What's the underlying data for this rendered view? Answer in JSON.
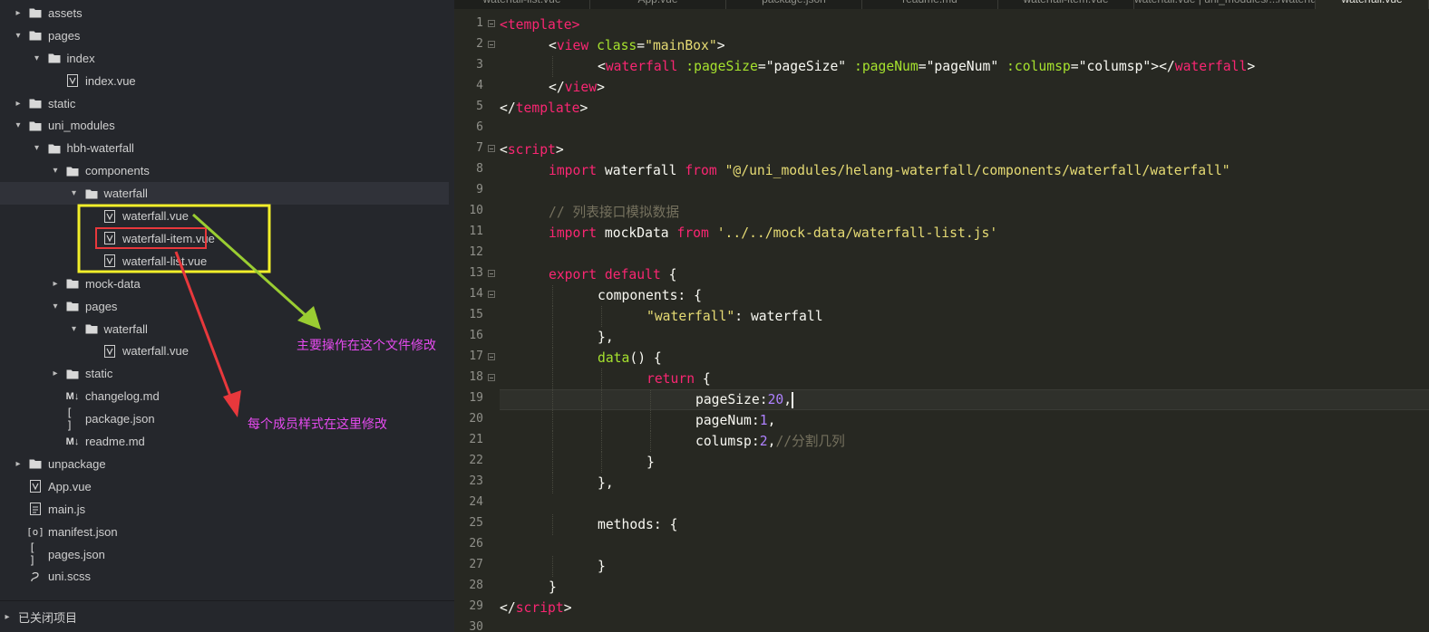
{
  "sidebar": {
    "tree": [
      {
        "label": "assets",
        "type": "folder",
        "depth": 0,
        "expanded": false
      },
      {
        "label": "pages",
        "type": "folder",
        "depth": 0,
        "expanded": true
      },
      {
        "label": "index",
        "type": "folder",
        "depth": 1,
        "expanded": true
      },
      {
        "label": "index.vue",
        "type": "vue",
        "depth": 2
      },
      {
        "label": "static",
        "type": "folder",
        "depth": 0,
        "expanded": false
      },
      {
        "label": "uni_modules",
        "type": "folder",
        "depth": 0,
        "expanded": true
      },
      {
        "label": "hbh-waterfall",
        "type": "folder",
        "depth": 1,
        "expanded": true
      },
      {
        "label": "components",
        "type": "folder",
        "depth": 2,
        "expanded": true
      },
      {
        "label": "waterfall",
        "type": "folder",
        "depth": 3,
        "expanded": true,
        "selected": true
      },
      {
        "label": "waterfall.vue",
        "type": "vue",
        "depth": 4
      },
      {
        "label": "waterfall-item.vue",
        "type": "vue",
        "depth": 4
      },
      {
        "label": "waterfall-list.vue",
        "type": "vue",
        "depth": 4
      },
      {
        "label": "mock-data",
        "type": "folder",
        "depth": 2,
        "expanded": false
      },
      {
        "label": "pages",
        "type": "folder",
        "depth": 2,
        "expanded": true
      },
      {
        "label": "waterfall",
        "type": "folder",
        "depth": 3,
        "expanded": true
      },
      {
        "label": "waterfall.vue",
        "type": "vue",
        "depth": 4
      },
      {
        "label": "static",
        "type": "folder",
        "depth": 2,
        "expanded": false
      },
      {
        "label": "changelog.md",
        "type": "md",
        "depth": 2
      },
      {
        "label": "package.json",
        "type": "json",
        "depth": 2
      },
      {
        "label": "readme.md",
        "type": "md",
        "depth": 2
      },
      {
        "label": "unpackage",
        "type": "folder",
        "depth": 0,
        "expanded": false
      },
      {
        "label": "App.vue",
        "type": "vue",
        "depth": 0
      },
      {
        "label": "main.js",
        "type": "js",
        "depth": 0
      },
      {
        "label": "manifest.json",
        "type": "manifest",
        "depth": 0
      },
      {
        "label": "pages.json",
        "type": "json",
        "depth": 0
      },
      {
        "label": "uni.scss",
        "type": "scss",
        "depth": 0
      }
    ],
    "closed_projects_label": "已关闭项目"
  },
  "tabs": [
    {
      "label": "waterfall-list.vue",
      "active": false
    },
    {
      "label": "App.vue",
      "active": false
    },
    {
      "label": "package.json",
      "active": false
    },
    {
      "label": "readme.md",
      "active": false
    },
    {
      "label": "waterfall-item.vue",
      "active": false
    },
    {
      "label": "waterfall.vue | uni_modules/.../waterfall",
      "active": false
    },
    {
      "label": "waterfall.vue",
      "active": true
    }
  ],
  "editor": {
    "current_line": 19,
    "lines": [
      {
        "n": 1,
        "fold": true,
        "indent": 0,
        "tokens": [
          [
            "tag",
            "<template"
          ],
          [
            "tag",
            ">"
          ]
        ]
      },
      {
        "n": 2,
        "fold": true,
        "indent": 1,
        "tokens": [
          [
            "plain",
            "<"
          ],
          [
            "tag",
            "view "
          ],
          [
            "attr",
            "class"
          ],
          [
            "plain",
            "="
          ],
          [
            "str",
            "\"mainBox\""
          ],
          [
            "plain",
            ">"
          ]
        ]
      },
      {
        "n": 3,
        "fold": false,
        "indent": 2,
        "tokens": [
          [
            "plain",
            "<"
          ],
          [
            "tag",
            "waterfall "
          ],
          [
            "attr",
            ":pageSize"
          ],
          [
            "plain",
            "="
          ],
          [
            "plain",
            "\"pageSize\" "
          ],
          [
            "attr",
            ":pageNum"
          ],
          [
            "plain",
            "="
          ],
          [
            "plain",
            "\"pageNum\" "
          ],
          [
            "attr",
            ":columsp"
          ],
          [
            "plain",
            "="
          ],
          [
            "plain",
            "\"columsp\">"
          ],
          [
            "plain",
            "</"
          ],
          [
            "tag",
            "waterfall"
          ],
          [
            "plain",
            ">"
          ]
        ]
      },
      {
        "n": 4,
        "fold": false,
        "indent": 1,
        "tokens": [
          [
            "plain",
            "</"
          ],
          [
            "tag",
            "view"
          ],
          [
            "plain",
            ">"
          ]
        ]
      },
      {
        "n": 5,
        "fold": false,
        "indent": 0,
        "tokens": [
          [
            "plain",
            "</"
          ],
          [
            "tag",
            "template"
          ],
          [
            "plain",
            ">"
          ]
        ]
      },
      {
        "n": 6,
        "fold": false,
        "indent": 0,
        "tokens": []
      },
      {
        "n": 7,
        "fold": true,
        "indent": 0,
        "tokens": [
          [
            "plain",
            "<"
          ],
          [
            "tag",
            "script"
          ],
          [
            "plain",
            ">"
          ]
        ]
      },
      {
        "n": 8,
        "fold": false,
        "indent": 1,
        "tokens": [
          [
            "tag",
            "import "
          ],
          [
            "plain",
            "waterfall "
          ],
          [
            "tag",
            "from "
          ],
          [
            "str",
            "\"@/uni_modules/helang-waterfall/components/waterfall/waterfall\""
          ]
        ]
      },
      {
        "n": 9,
        "fold": false,
        "indent": 0,
        "tokens": []
      },
      {
        "n": 10,
        "fold": false,
        "indent": 1,
        "tokens": [
          [
            "cmt",
            "// 列表接口模拟数据"
          ]
        ]
      },
      {
        "n": 11,
        "fold": false,
        "indent": 1,
        "tokens": [
          [
            "tag",
            "import "
          ],
          [
            "plain",
            "mockData "
          ],
          [
            "tag",
            "from "
          ],
          [
            "str",
            "'../../mock-data/waterfall-list.js'"
          ]
        ]
      },
      {
        "n": 12,
        "fold": false,
        "indent": 0,
        "tokens": []
      },
      {
        "n": 13,
        "fold": true,
        "indent": 1,
        "tokens": [
          [
            "tag",
            "export default "
          ],
          [
            "plain",
            "{"
          ]
        ]
      },
      {
        "n": 14,
        "fold": true,
        "indent": 2,
        "tokens": [
          [
            "plain",
            "components: {"
          ]
        ]
      },
      {
        "n": 15,
        "fold": false,
        "indent": 3,
        "tokens": [
          [
            "str",
            "\"waterfall\""
          ],
          [
            "plain",
            ": waterfall"
          ]
        ]
      },
      {
        "n": 16,
        "fold": false,
        "indent": 2,
        "tokens": [
          [
            "plain",
            "},"
          ]
        ]
      },
      {
        "n": 17,
        "fold": true,
        "indent": 2,
        "tokens": [
          [
            "attr",
            "data"
          ],
          [
            "plain",
            "() {"
          ]
        ]
      },
      {
        "n": 18,
        "fold": true,
        "indent": 3,
        "tokens": [
          [
            "tag",
            "return "
          ],
          [
            "plain",
            "{"
          ]
        ]
      },
      {
        "n": 19,
        "fold": false,
        "indent": 4,
        "tokens": [
          [
            "plain",
            "pageSize:"
          ],
          [
            "num",
            "20"
          ],
          [
            "plain",
            ","
          ]
        ]
      },
      {
        "n": 20,
        "fold": false,
        "indent": 4,
        "tokens": [
          [
            "plain",
            "pageNum:"
          ],
          [
            "num",
            "1"
          ],
          [
            "plain",
            ","
          ]
        ]
      },
      {
        "n": 21,
        "fold": false,
        "indent": 4,
        "tokens": [
          [
            "plain",
            "columsp:"
          ],
          [
            "num",
            "2"
          ],
          [
            "plain",
            ","
          ],
          [
            "cmt",
            "//分割几列"
          ]
        ]
      },
      {
        "n": 22,
        "fold": false,
        "indent": 3,
        "tokens": [
          [
            "plain",
            "}"
          ]
        ]
      },
      {
        "n": 23,
        "fold": false,
        "indent": 2,
        "tokens": [
          [
            "plain",
            "},"
          ]
        ]
      },
      {
        "n": 24,
        "fold": false,
        "indent": 0,
        "tokens": []
      },
      {
        "n": 25,
        "fold": false,
        "indent": 2,
        "tokens": [
          [
            "plain",
            "methods: {"
          ]
        ]
      },
      {
        "n": 26,
        "fold": false,
        "indent": 0,
        "tokens": []
      },
      {
        "n": 27,
        "fold": false,
        "indent": 2,
        "tokens": [
          [
            "plain",
            "}"
          ]
        ]
      },
      {
        "n": 28,
        "fold": false,
        "indent": 1,
        "tokens": [
          [
            "plain",
            "}"
          ]
        ]
      },
      {
        "n": 29,
        "fold": false,
        "indent": 0,
        "tokens": [
          [
            "plain",
            "</"
          ],
          [
            "tag",
            "script"
          ],
          [
            "plain",
            ">"
          ]
        ]
      },
      {
        "n": 30,
        "fold": false,
        "indent": 0,
        "tokens": []
      }
    ]
  },
  "annotations": {
    "main_file_note": "主要操作在这个文件修改",
    "item_style_note": "每个成员样式在这里修改",
    "colors": {
      "yellow_box": "#f2ef2a",
      "red_box": "#e8383c",
      "green_arrow": "#9acd32",
      "red_arrow": "#e8383c",
      "note_text": "#e64bf0"
    }
  },
  "theme": {
    "sidebar_bg": "#25272c",
    "editor_bg": "#272822",
    "tag": "#f92672",
    "attr": "#a6e22e",
    "string": "#e6db74",
    "number": "#ae81ff",
    "comment": "#75715e"
  }
}
